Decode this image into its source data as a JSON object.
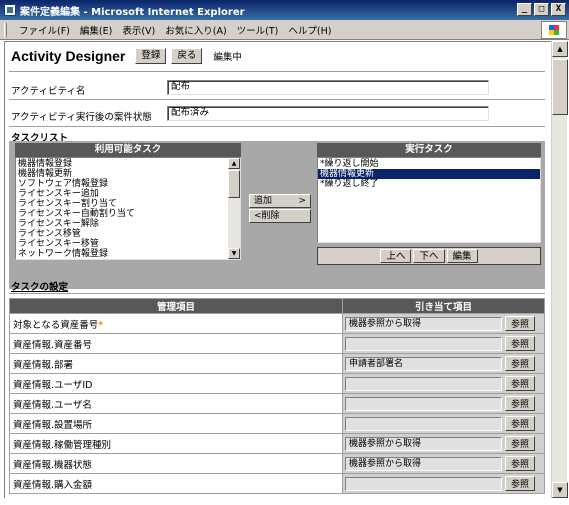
{
  "window": {
    "title": "案件定義編集 - Microsoft Internet Explorer",
    "minimize": "_",
    "maximize": "□",
    "close": "X"
  },
  "menu": [
    "ファイル(F)",
    "編集(E)",
    "表示(V)",
    "お気に入り(A)",
    "ツール(T)",
    "ヘルプ(H)"
  ],
  "header": {
    "title": "Activity Designer",
    "register": "登録",
    "back": "戻る",
    "status": "編集中"
  },
  "form": {
    "activity_name_label": "アクティビティ名",
    "activity_name_value": "配布",
    "post_state_label": "アクティビティ実行後の案件状態",
    "post_state_value": "配布済み"
  },
  "task_list": {
    "section": "タスクリスト",
    "available_header": "利用可能タスク",
    "available": [
      "機器情報登録",
      "機器情報更新",
      "ソフトウェア情報登録",
      "ライセンスキー追加",
      "ライセンスキー割り当て",
      "ライセンスキー自動割り当て",
      "ライセンスキー解除",
      "ライセンス移管",
      "ライセンスキー移管",
      "ネットワーク情報登録"
    ],
    "add": "追加",
    "add_arrow": ">",
    "remove": "削除",
    "remove_arrow": "<",
    "exec_header": "実行タスク",
    "exec": [
      "*繰り返し開始",
      "機器情報更新",
      "*繰り返し終了"
    ],
    "exec_selected_index": 1,
    "up": "上へ",
    "down": "下へ",
    "edit": "編集"
  },
  "settings": {
    "section": "タスクの設定",
    "col1": "管理項目",
    "col2": "引き当て項目",
    "ref_label": "参照",
    "rows": [
      {
        "item": "対象となる資産番号",
        "required": "*",
        "value": "機器参照から取得"
      },
      {
        "item": "資産情報.資産番号",
        "required": "",
        "value": ""
      },
      {
        "item": "資産情報.部署",
        "required": "",
        "value": "申請者部署名"
      },
      {
        "item": "資産情報.ユーザID",
        "required": "",
        "value": ""
      },
      {
        "item": "資産情報.ユーザ名",
        "required": "",
        "value": ""
      },
      {
        "item": "資産情報.設置場所",
        "required": "",
        "value": ""
      },
      {
        "item": "資産情報.稼働管理種別",
        "required": "",
        "value": "機器参照から取得"
      },
      {
        "item": "資産情報.機器状態",
        "required": "",
        "value": "機器参照から取得"
      },
      {
        "item": "資産情報.購入金額",
        "required": "",
        "value": ""
      }
    ]
  }
}
